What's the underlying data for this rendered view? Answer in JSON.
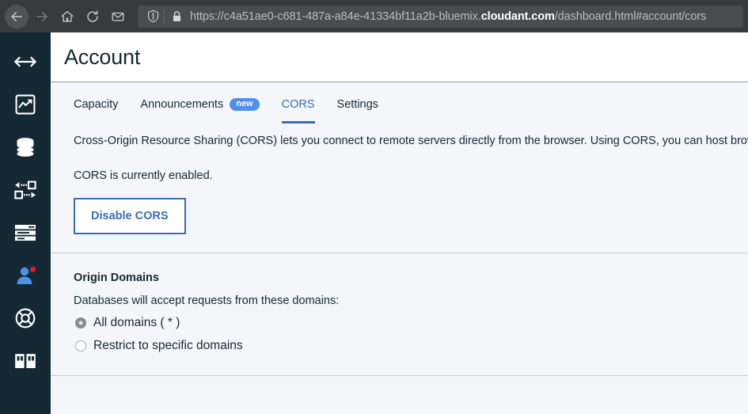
{
  "browser": {
    "back_label": "Back",
    "forward_label": "Forward",
    "home_label": "Home",
    "reload_label": "Reload",
    "mail_label": "Mail",
    "shield_label": "Tracking protection",
    "lock_label": "Secure connection",
    "url_prefix": "https://c4a51ae0-c681-487a-a84e-41334bf11a2b-bluemix.",
    "url_domain": "cloudant.com",
    "url_suffix": "/dashboard.html#account/cors",
    "url_full": "https://c4a51ae0-c681-487a-a84e-41334bf11a2b-bluemix.cloudant.com/dashboard.html#account/cors"
  },
  "sidebar": {
    "items": [
      {
        "name": "expand-collapse",
        "label": "Expand navigation"
      },
      {
        "name": "monitoring",
        "label": "Monitoring"
      },
      {
        "name": "databases",
        "label": "Databases"
      },
      {
        "name": "replication",
        "label": "Replication"
      },
      {
        "name": "jobs",
        "label": "Jobs"
      },
      {
        "name": "account",
        "label": "Account",
        "active": true,
        "badge": true
      },
      {
        "name": "support",
        "label": "Support"
      },
      {
        "name": "docs",
        "label": "Docs"
      }
    ]
  },
  "header": {
    "title": "Account"
  },
  "tabs": [
    {
      "label": "Capacity",
      "active": false
    },
    {
      "label": "Announcements",
      "active": false,
      "badge": "new"
    },
    {
      "label": "CORS",
      "active": true
    },
    {
      "label": "Settings",
      "active": false
    }
  ],
  "cors": {
    "description": "Cross-Origin Resource Sharing (CORS) lets you connect to remote servers directly from the browser. Using CORS, you can host browser-b",
    "status": "CORS is currently enabled.",
    "toggle_button_label": "Disable CORS"
  },
  "origin_domains": {
    "title": "Origin Domains",
    "description": "Databases will accept requests from these domains:",
    "options": [
      {
        "label": "All domains ( * )",
        "selected": true
      },
      {
        "label": "Restrict to specific domains",
        "selected": false
      }
    ]
  },
  "colors": {
    "accent_blue": "#3b6eb4",
    "badge_blue": "#4d91e8",
    "sidebar_navy": "#152935",
    "notification_red": "#e0182d",
    "page_bg": "#f4f6f9",
    "text_dark": "#152935"
  }
}
